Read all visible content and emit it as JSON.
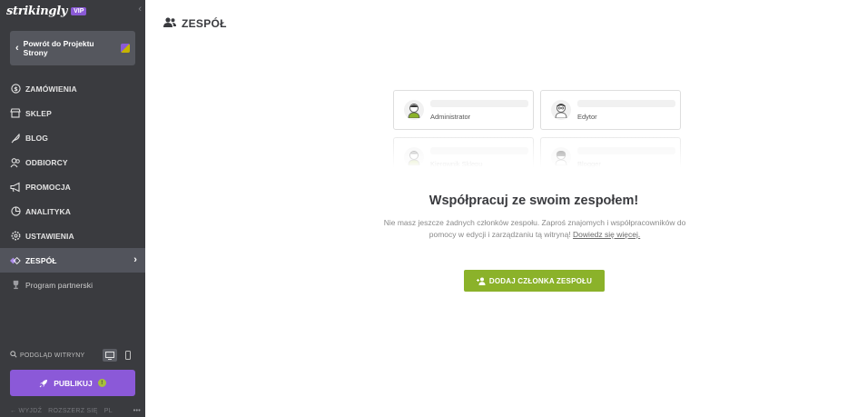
{
  "brand": {
    "logo": "strikingly",
    "badge": "VIP"
  },
  "sidebar": {
    "back_label": "Powrót do Projektu Strony",
    "items": [
      {
        "label": "ZAMÓWIENIA",
        "icon": "dollar-icon"
      },
      {
        "label": "SKLEP",
        "icon": "store-icon"
      },
      {
        "label": "BLOG",
        "icon": "quill-icon"
      },
      {
        "label": "ODBIORCY",
        "icon": "audience-icon"
      },
      {
        "label": "PROMOCJA",
        "icon": "megaphone-icon"
      },
      {
        "label": "ANALITYKA",
        "icon": "pie-chart-icon"
      },
      {
        "label": "USTAWIENIA",
        "icon": "gear-icon"
      },
      {
        "label": "ZESPÓŁ",
        "icon": "team-diamond-icon",
        "active": true
      },
      {
        "label": "Program partnerski",
        "icon": "trophy-icon"
      }
    ],
    "preview_label": "PODGLĄD WITRYNY",
    "publish_label": "PUBLIKUJ",
    "footer": {
      "exit": "WYJDŹ",
      "expand": "ROZSZERZ SIĘ",
      "lang": "PL"
    }
  },
  "main": {
    "title": "ZESPÓŁ",
    "roles": [
      "Administrator",
      "Edytor",
      "Kierownik Sklepu",
      "Blogger"
    ],
    "empty_title": "Współpracuj ze swoim zespołem!",
    "empty_desc": "Nie masz jeszcze żadnych członków zespołu. Zaproś znajomych i współpracowników do pomocy w edycji i zarządzaniu tą witryną!",
    "learn_more": "Dowiedz się więcej.",
    "add_button": "DODAJ CZŁONKA ZESPOŁU"
  },
  "colors": {
    "sidebar_bg": "#3a3b3f",
    "accent_purple": "#8b59d8",
    "accent_green": "#8bb22a"
  }
}
